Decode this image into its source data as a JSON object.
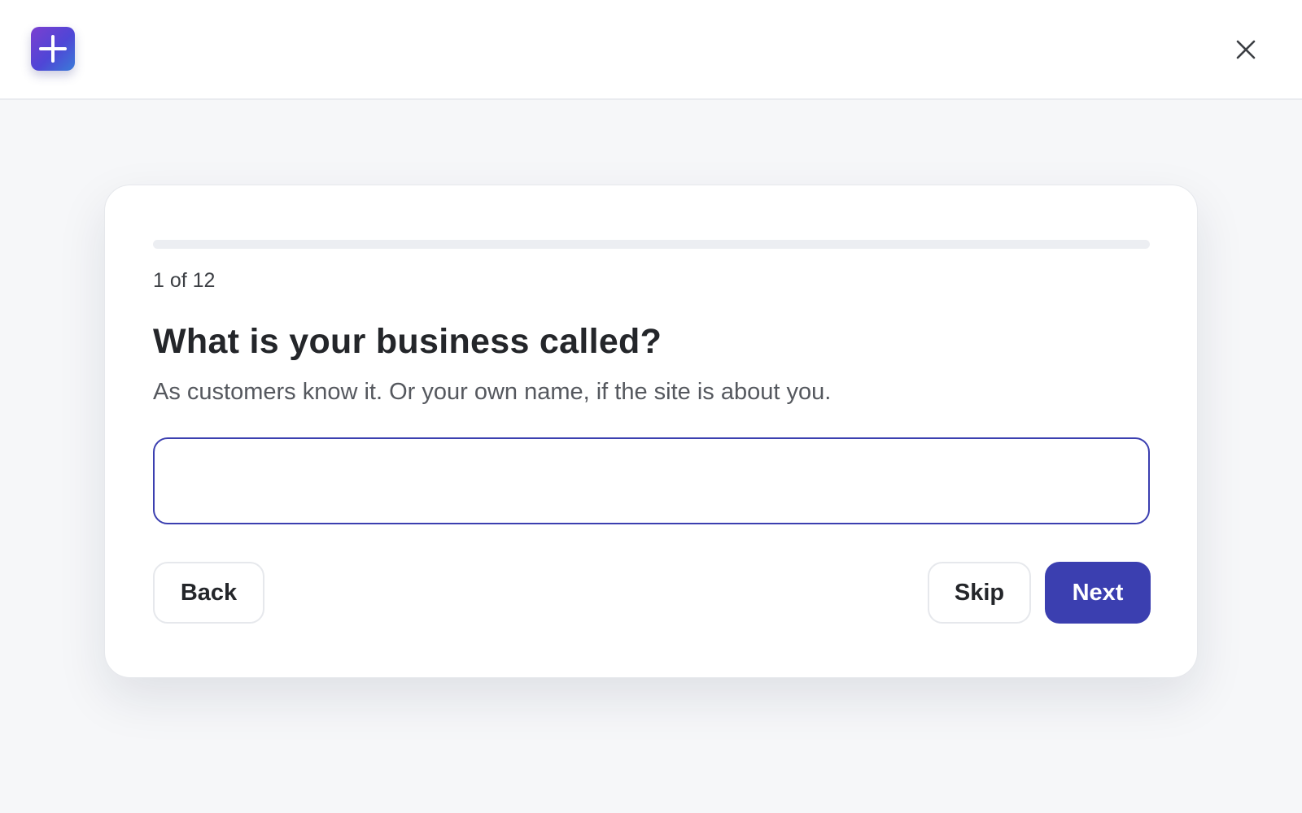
{
  "header": {
    "logo_icon": "plus-icon",
    "close_icon": "close-icon",
    "brand_gradient": [
      "#7b3fd0",
      "#4f46d6",
      "#3a7bd8"
    ]
  },
  "wizard": {
    "progress": {
      "current": 1,
      "total": 12,
      "fraction": 0.0
    },
    "step_label": "1 of 12",
    "question": "What is your business called?",
    "help_text": "As customers know it. Or your own name, if the site is about you.",
    "input": {
      "value": "",
      "placeholder": ""
    },
    "buttons": {
      "back": "Back",
      "skip": "Skip",
      "next": "Next"
    }
  },
  "colors": {
    "accent": "#3b3fb0",
    "background": "#f6f7f9",
    "card": "#ffffff"
  }
}
